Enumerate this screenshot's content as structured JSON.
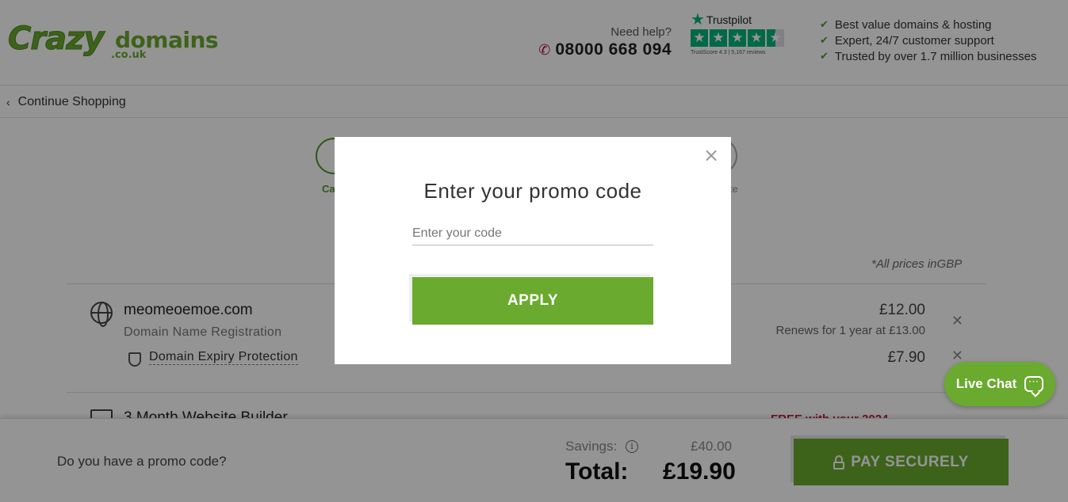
{
  "header": {
    "logo_crazy": "Crazy",
    "logo_domains": "domains",
    "logo_couk": ".co.uk",
    "help_label": "Need help?",
    "phone": "08000 668 094",
    "trustpilot": {
      "name": "Trustpilot",
      "score_text": "TrustScore 4.3 | 5,167 reviews",
      "rating": 4.5
    },
    "usps": [
      "Best value domains & hosting",
      "Expert, 24/7 customer support",
      "Trusted by over 1.7 million businesses"
    ]
  },
  "continue_shopping": "Continue Shopping",
  "steps": {
    "left_label": "Ca",
    "right_label": "ete"
  },
  "prices_note": "*All prices inGBP",
  "cart": {
    "item1": {
      "name": "meomeoemoe.com",
      "sub": "Domain Name Registration",
      "price": "£12.00",
      "renew": "Renews for 1 year at £13.00",
      "addon_name": "Domain Expiry Protection",
      "addon_price": "£7.90"
    },
    "item2": {
      "name": "3 Month Website Builder",
      "free": "FREE with your 2024"
    }
  },
  "footer": {
    "promo_question": "Do you have a promo code?",
    "savings_label": "Savings:",
    "savings_value": "£40.00",
    "total_label": "Total:",
    "total_value": "£19.90",
    "pay_label": "PAY SECURELY"
  },
  "live_chat": {
    "label": "Live Chat",
    "icon": "chat-bubble-icon"
  },
  "modal": {
    "title": "Enter your promo code",
    "input_placeholder": "Enter your code",
    "input_value": "",
    "apply_label": "APPLY",
    "close_glyph": "×"
  },
  "colors": {
    "brand_green": "#6aaa2e",
    "overlay": "rgba(0,0,0,0.42)",
    "phone_icon": "#b8123b",
    "trustpilot_green": "#00b67a"
  }
}
